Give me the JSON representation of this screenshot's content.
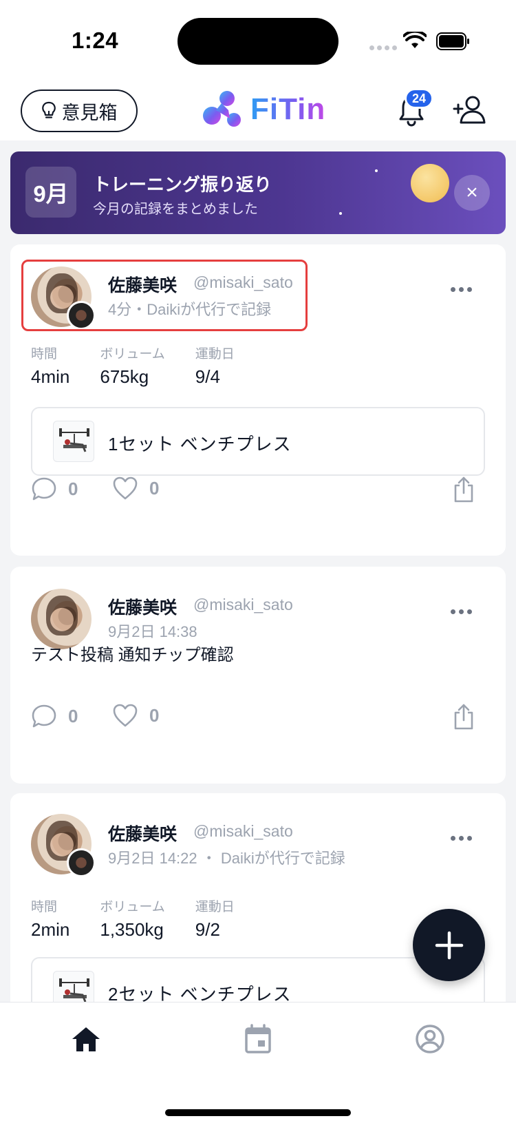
{
  "status_bar": {
    "time": "1:24"
  },
  "header": {
    "opinion_label": "意見箱",
    "logo_text": "FiTin",
    "notification_count": "24",
    "accent_color": "#2563eb"
  },
  "banner": {
    "month": "9月",
    "title": "トレーニング振り返り",
    "subtitle": "今月の記録をまとめました",
    "close_icon": "×"
  },
  "posts": [
    {
      "name": "佐藤美咲",
      "handle": "@misaki_sato",
      "meta": "4分・Daikiが代行で記録",
      "stats": [
        {
          "label": "時間",
          "value": "4min"
        },
        {
          "label": "ボリューム",
          "value": "675kg"
        },
        {
          "label": "運動日",
          "value": "9/4"
        }
      ],
      "exercise": "1セット  ベンチプレス",
      "comments": "0",
      "likes": "0"
    },
    {
      "name": "佐藤美咲",
      "handle": "@misaki_sato",
      "meta": "9月2日 14:38",
      "text": "テスト投稿 通知チップ確認",
      "comments": "0",
      "likes": "0"
    },
    {
      "name": "佐藤美咲",
      "handle": "@misaki_sato",
      "meta": "9月2日 14:22 ・ Daikiが代行で記録",
      "stats": [
        {
          "label": "時間",
          "value": "2min"
        },
        {
          "label": "ボリューム",
          "value": "1,350kg"
        },
        {
          "label": "運動日",
          "value": "9/2"
        }
      ],
      "exercise": "2セット  ベンチプレス"
    }
  ],
  "icons": {
    "header": [
      "lightbulb-icon",
      "bell-icon",
      "add-user-icon"
    ],
    "post_actions": [
      "comment-icon",
      "heart-icon",
      "share-icon",
      "more-icon"
    ],
    "nav": [
      "home-icon",
      "calendar-icon",
      "profile-icon"
    ],
    "fab": "plus-icon"
  }
}
